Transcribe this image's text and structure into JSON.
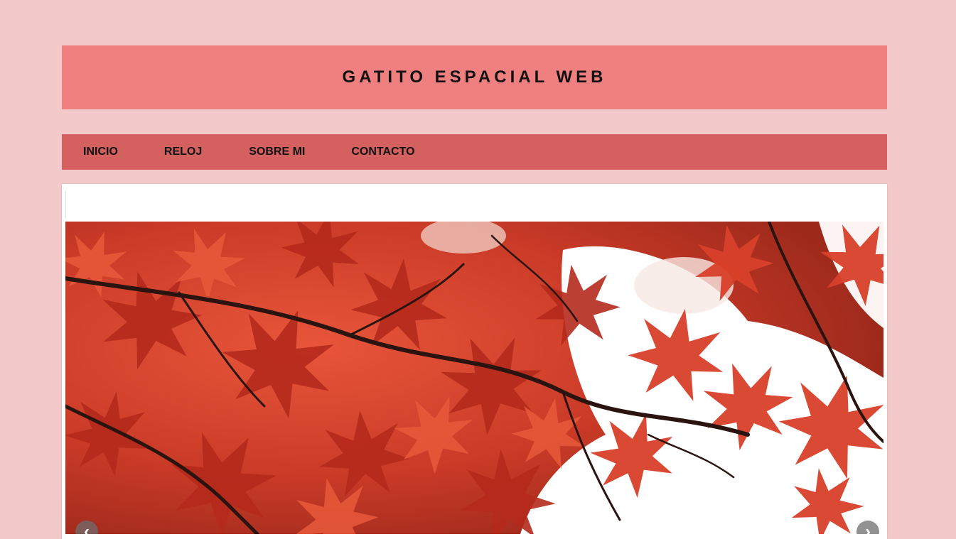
{
  "header": {
    "title": "GATITO ESPACIAL WEB"
  },
  "nav": {
    "items": [
      {
        "label": "INICIO"
      },
      {
        "label": "RELOJ"
      },
      {
        "label": "SOBRE MI"
      },
      {
        "label": "CONTACTO"
      }
    ]
  },
  "slider": {
    "image": "red-maple-leaves-photo",
    "prev_icon": "‹",
    "next_icon": "›"
  },
  "colors": {
    "page_background": "#f3c9c9",
    "header_background": "#f08080",
    "nav_background": "#d46060",
    "content_background": "#ffffff"
  }
}
